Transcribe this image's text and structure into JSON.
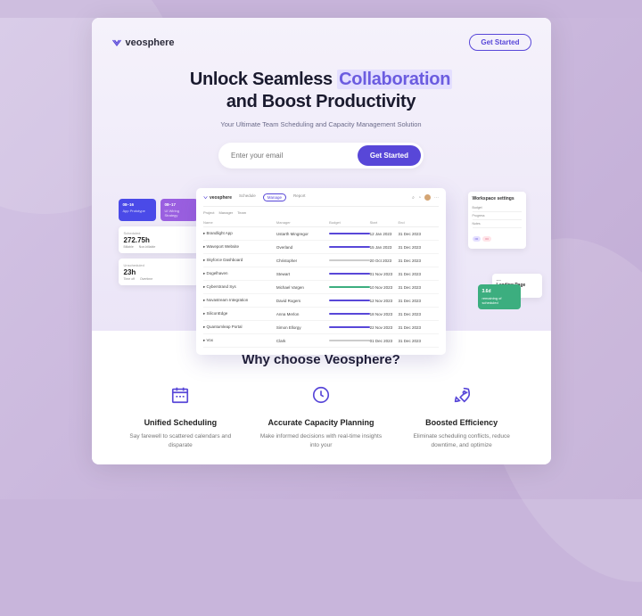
{
  "brand": "veosphere",
  "nav": {
    "cta": "Get Started"
  },
  "hero": {
    "title_pre": "Unlock Seamless ",
    "title_hl": "Collaboration",
    "title_post": "and Boost Productivity",
    "subtitle": "Your Ultimate Team Scheduling and Capacity Management Solution",
    "email_placeholder": "Enter your email",
    "email_cta": "Get Started"
  },
  "mockup": {
    "brand": "veosphere",
    "tabs": [
      "Schedule",
      "Manage",
      "Report"
    ],
    "filters": [
      "Project",
      "Manager",
      "Team"
    ],
    "columns": [
      "Name",
      "Manager",
      "Budget",
      "Start",
      "End",
      ""
    ],
    "rows": [
      {
        "name": "Brandlight App",
        "manager": "Ustarth Mingregor",
        "budget": "blue",
        "start": "12 Jan 2023",
        "end": "31 Dec 2023"
      },
      {
        "name": "Waveport Website",
        "manager": "Overland",
        "budget": "blue",
        "start": "15 Jan 2023",
        "end": "31 Dec 2023"
      },
      {
        "name": "Skyforce Dashboard",
        "manager": "Christopher",
        "budget": "gray",
        "start": "20 Oct 2023",
        "end": "31 Dec 2023"
      },
      {
        "name": "Dogelhaven",
        "manager": "Stewart",
        "budget": "blue",
        "start": "01 Nov 2023",
        "end": "31 Dec 2023"
      },
      {
        "name": "Cyberstrand Sys",
        "manager": "Michael Vargen",
        "budget": "green",
        "start": "10 Nov 2023",
        "end": "31 Dec 2023"
      },
      {
        "name": "Novastream Integration",
        "manager": "David Rogers",
        "budget": "blue",
        "start": "12 Nov 2023",
        "end": "31 Dec 2023"
      },
      {
        "name": "SiliconEdge",
        "manager": "Anna Merlon",
        "budget": "blue",
        "start": "18 Nov 2023",
        "end": "31 Dec 2023"
      },
      {
        "name": "Quantumleap Portal",
        "manager": "Simon Ellorgy",
        "budget": "blue",
        "start": "22 Nov 2023",
        "end": "31 Dec 2023"
      },
      {
        "name": "Vox",
        "manager": "Clark",
        "budget": "gray",
        "start": "01 Dec 2023",
        "end": "31 Dec 2023"
      }
    ]
  },
  "cards": {
    "blue": {
      "title": "08–16",
      "sub": "App Prototype"
    },
    "purple": {
      "title": "08–17",
      "sub": "UI Wiring Strategy"
    },
    "stats1": {
      "label": "Scheduled",
      "value": "272.75h",
      "sub1": "Billable",
      "sub2": "Non-billable"
    },
    "stats2": {
      "label": "Unscheduled",
      "value": "23h",
      "sub1": "Time off",
      "sub2": "Overtime"
    },
    "settings": {
      "title": "Workspace settings",
      "items": [
        "Budget",
        "Progress",
        "Notes"
      ]
    },
    "green": {
      "title": "3.6d",
      "sub": "remaining of scheduled"
    },
    "landing": {
      "title": "Landing Page Design"
    }
  },
  "features": {
    "heading": "Why choose Veosphere?",
    "items": [
      {
        "title": "Unified Scheduling",
        "desc": "Say farewell to scattered calendars and disparate"
      },
      {
        "title": "Accurate Capacity Planning",
        "desc": "Make informed decisions with real-time insights into your"
      },
      {
        "title": "Boosted Efficiency",
        "desc": "Eliminate scheduling conflicts, reduce downtime, and optimize"
      }
    ]
  }
}
